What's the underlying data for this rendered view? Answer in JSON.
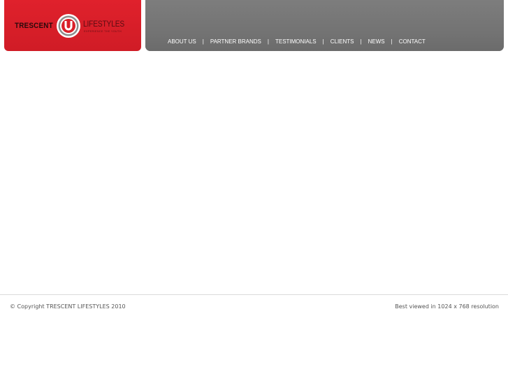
{
  "logo": {
    "word_left": "TRESCENT",
    "word_right": "LIFESTYLES",
    "tagline": "EXPERIENCE THE YOUTH",
    "brand_color": "#d91f29"
  },
  "nav": {
    "items": [
      {
        "label": "ABOUT US"
      },
      {
        "label": "PARTNER BRANDS"
      },
      {
        "label": "TESTIMONIALS"
      },
      {
        "label": "CLIENTS"
      },
      {
        "label": "NEWS"
      },
      {
        "label": "CONTACT"
      }
    ],
    "separator": "|",
    "background_color": "#777777"
  },
  "footer": {
    "copyright": "© Copyright TRESCENT LIFESTYLES 2010",
    "resolution_note": "Best viewed in 1024 x 768 resolution"
  }
}
